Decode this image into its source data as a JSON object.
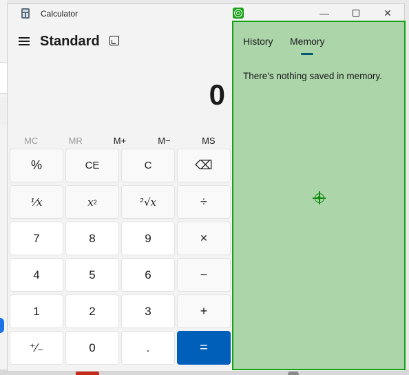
{
  "window": {
    "title": "Calculator",
    "minimize_glyph": "—",
    "close_glyph": "✕"
  },
  "header": {
    "mode": "Standard"
  },
  "display": {
    "value": "0"
  },
  "memory_buttons": [
    {
      "label": "MC",
      "enabled": false
    },
    {
      "label": "MR",
      "enabled": false
    },
    {
      "label": "M+",
      "enabled": true
    },
    {
      "label": "M−",
      "enabled": true
    },
    {
      "label": "MS",
      "enabled": true
    }
  ],
  "keys": {
    "percent": "%",
    "ce": "CE",
    "clear": "C",
    "backspace": "⌫",
    "reciprocal": "¹⁄𝑥",
    "square_base": "x",
    "square_exp": "2",
    "sqrt": "²√x",
    "divide": "÷",
    "seven": "7",
    "eight": "8",
    "nine": "9",
    "multiply": "×",
    "four": "4",
    "five": "5",
    "six": "6",
    "minus": "−",
    "one": "1",
    "two": "2",
    "three": "3",
    "plus": "+",
    "negate": "⁺∕₋",
    "zero": "0",
    "decimal": ".",
    "equals": "="
  },
  "panel": {
    "tabs": [
      {
        "label": "History",
        "active": false
      },
      {
        "label": "Memory",
        "active": true
      }
    ],
    "message": "There's nothing saved in memory."
  },
  "colors": {
    "accent": "#005fb8",
    "overlay_fill": "#acd5a9",
    "overlay_border": "#16a216",
    "tab_underline": "#005a70"
  },
  "icons": {
    "app": "calculator-icon",
    "menu": "hamburger-icon",
    "keep_on_top": "keep-on-top-icon",
    "backspace": "backspace-icon",
    "overlay": "target-icon",
    "crosshair": "crosshair-icon"
  }
}
